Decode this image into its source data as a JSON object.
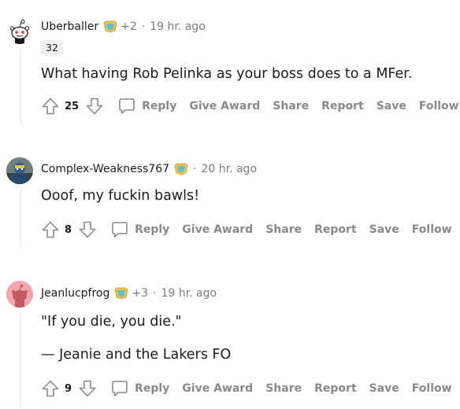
{
  "colors": {
    "meta_gray": "#787c7e",
    "action_gray": "#878a8c",
    "thread": "#edeff1",
    "flair_bg": "#f0f0f0"
  },
  "icons": {
    "upvote": "upvote-arrow-icon",
    "downvote": "downvote-arrow-icon",
    "reply": "chat-bubble-icon",
    "award": "award-badge-icon"
  },
  "comments": [
    {
      "user": "Uberballer",
      "award_extra": "+2",
      "separator": "·",
      "time": "19 hr. ago",
      "flair": "32",
      "lines": [
        "What having Rob Pelinka as your boss does to a MFer."
      ],
      "score": "25",
      "actions": [
        "Reply",
        "Give Award",
        "Share",
        "Report",
        "Save",
        "Follow"
      ]
    },
    {
      "user": "Complex-Weakness767",
      "separator": "·",
      "time": "20 hr. ago",
      "lines": [
        "Ooof, my fuckin bawls!"
      ],
      "score": "8",
      "actions": [
        "Reply",
        "Give Award",
        "Share",
        "Report",
        "Save",
        "Follow"
      ]
    },
    {
      "user": "Jeanlucpfrog",
      "award_extra": "+3",
      "separator": "·",
      "time": "19 hr. ago",
      "lines": [
        "\"If you die, you die.\"",
        "— Jeanie and the Lakers FO"
      ],
      "score": "9",
      "actions": [
        "Reply",
        "Give Award",
        "Share",
        "Report",
        "Save",
        "Follow"
      ]
    }
  ]
}
